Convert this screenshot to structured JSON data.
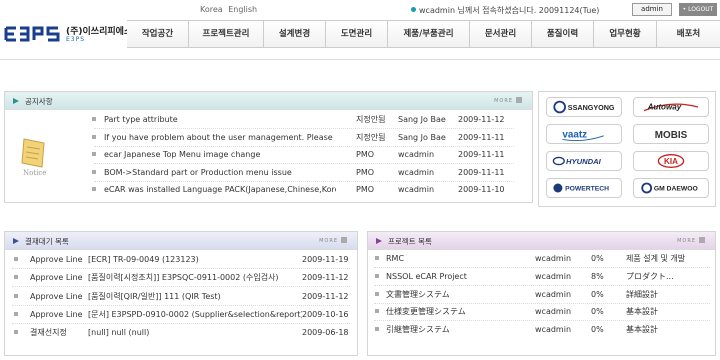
{
  "header": {
    "languages": [
      "Korea",
      "English"
    ],
    "welcome": "wcadmin 님께서 접속하셨습니다. 20091124(Tue)",
    "admin_label": "admin",
    "logout_label": "• LOGOUT"
  },
  "logo": {
    "name": "(주)이쓰리피에스",
    "sub": "E3PS"
  },
  "nav": {
    "items": [
      "작업공간",
      "프로젝트관리",
      "설계변경",
      "도면관리",
      "제품/부품관리",
      "문서관리",
      "품질이력",
      "업무현황",
      "배포처"
    ]
  },
  "notice": {
    "title": "공지사항",
    "more": "MORE",
    "icon_label": "Notice",
    "rows": [
      {
        "title": "Part type attribute",
        "type": "지정안됨",
        "author": "Sang Jo Bae",
        "date": "2009-11-12"
      },
      {
        "title": "If you have problem about the user management. Please",
        "type": "지정안됨",
        "author": "Sang Jo Bae",
        "date": "2009-11-11"
      },
      {
        "title": "ecar Japanese Top Menu image change",
        "type": "PMO",
        "author": "wcadmin",
        "date": "2009-11-11"
      },
      {
        "title": "BOM->Standard part or Production menu issue",
        "type": "PMO",
        "author": "wcadmin",
        "date": "2009-11-11"
      },
      {
        "title": "eCAR was installed Language PACK(Japanese,Chinese,Korean",
        "type": "PMO",
        "author": "wcadmin",
        "date": "2009-11-10"
      }
    ]
  },
  "brands": {
    "items": [
      "SSANGYONG",
      "Autoway",
      "vaatz",
      "MOBIS",
      "HYUNDAI",
      "KIA",
      "POWERTECH",
      "GM DAEWOO"
    ]
  },
  "approval": {
    "title": "결재대기 목록",
    "more": "MORE",
    "rows": [
      {
        "status": "Approve Line",
        "desc": "[ECR] TR-09-0049 (123123)",
        "date": "2009-11-19"
      },
      {
        "status": "Approve Line",
        "desc": "[품질이력[시정조치]] E3PSQC-0911-0002 (수입검사)",
        "date": "2009-11-12"
      },
      {
        "status": "Approve Line",
        "desc": "[품질이력[QIR/일반]] 111 (QIR Test)",
        "date": "2009-11-12"
      },
      {
        "status": "Approve Line",
        "desc": "[문서] E3PSPD-0910-0002 (Supplier&selection&report)",
        "date": "2009-10-16"
      },
      {
        "status": "결재선지정",
        "desc": "[null] null (null)",
        "date": "2009-06-18"
      }
    ]
  },
  "projects": {
    "title": "프로젝트 목록",
    "more": "MORE",
    "rows": [
      {
        "name": "RMC",
        "owner": "wcadmin",
        "progress": "0%",
        "status": "제품 설계 및 개발"
      },
      {
        "name": "NSSOL eCAR Project",
        "owner": "wcadmin",
        "progress": "8%",
        "status": "プロダクト..."
      },
      {
        "name": "文書管理システム",
        "owner": "wcadmin",
        "progress": "0%",
        "status": "詳細設計"
      },
      {
        "name": "仕様変更管理システム",
        "owner": "wcadmin",
        "progress": "0%",
        "status": "基本設計"
      },
      {
        "name": "引継管理システム",
        "owner": "wcadmin",
        "progress": "0%",
        "status": "基本設計"
      }
    ]
  },
  "colors": {
    "notice_head": "#d9ecec",
    "approval_head": "#dfe4f2",
    "projects_head": "#ece0ee",
    "accent": "#1a9bb8"
  }
}
